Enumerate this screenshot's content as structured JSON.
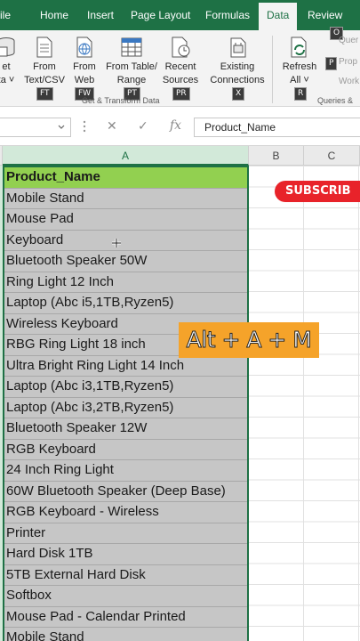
{
  "ribbon_tabs": [
    "ile",
    "Home",
    "Insert",
    "Page Layout",
    "Formulas",
    "Data",
    "Review"
  ],
  "active_tab": "Data",
  "ribbon": {
    "get_data": {
      "line1": "et",
      "line2": "ta ˅",
      "keytip": ""
    },
    "from_text_csv": {
      "line1": "From",
      "line2": "Text/CSV",
      "keytip": "FT"
    },
    "from_web": {
      "line1": "From",
      "line2": "Web",
      "keytip": "FW"
    },
    "from_table_range": {
      "line1": "From Table/",
      "line2": "Range",
      "keytip": "PT"
    },
    "recent_sources": {
      "line1": "Recent",
      "line2": "Sources",
      "keytip": "PR"
    },
    "existing_connections": {
      "line1": "Existing",
      "line2": "Connections",
      "keytip": "X"
    },
    "refresh_all": {
      "line1": "Refresh",
      "line2": "All ˅",
      "keytip": "R"
    },
    "group_get_transform": "Get & Transform Data",
    "group_queries": "Queries &",
    "side_queries": "Quer",
    "side_properties": "Prop",
    "side_workbook": "Work",
    "keytip_o": "O",
    "keytip_p": "P"
  },
  "formula_bar": {
    "fx_symbol": "fx",
    "cancel_symbol": "✕",
    "enter_symbol": "✓",
    "value": "Product_Name"
  },
  "columns": [
    "A",
    "B",
    "C"
  ],
  "cells": [
    "Product_Name",
    "Mobile Stand",
    "Mouse Pad",
    "Keyboard",
    "Bluetooth Speaker 50W",
    "Ring Light 12 Inch",
    "Laptop (Abc i5,1TB,Ryzen5)",
    "Wireless Keyboard",
    "RBG Ring Light 18 inch",
    "Ultra Bright Ring Light 14 Inch",
    "Laptop (Abc i3,1TB,Ryzen5)",
    "Laptop (Abc i3,2TB,Ryzen5)",
    "Bluetooth Speaker 12W",
    "RGB Keyboard",
    "24 Inch Ring Light",
    "60W Bluetooth Speaker (Deep Base)",
    "RGB Keyboard - Wireless",
    "Printer",
    "Hard Disk 1TB",
    "5TB External Hard Disk",
    "Softbox",
    "Mouse Pad - Calendar Printed",
    "Mobile Stand"
  ],
  "overlay": {
    "shortcut": "Alt + A + M",
    "subscribe": "SUBSCRIB"
  },
  "colors": {
    "excel_green": "#1e7145",
    "header_fill": "#92d050",
    "selection_fill": "#c6c6c6",
    "shortcut_bg": "#f5a32a",
    "subscribe_bg": "#e8232a"
  }
}
